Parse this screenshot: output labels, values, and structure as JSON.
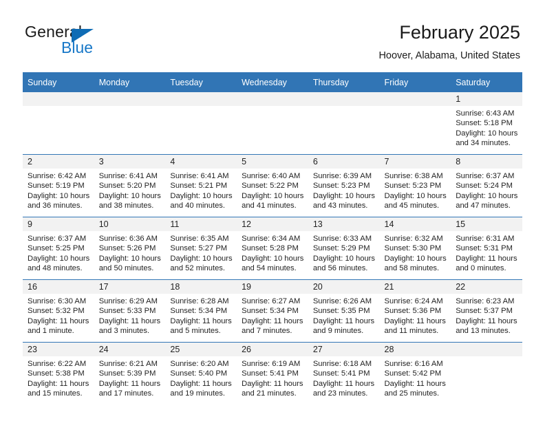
{
  "brand": {
    "name_part1": "General",
    "name_part2": "Blue"
  },
  "header": {
    "title": "February 2025",
    "subtitle": "Hoover, Alabama, United States"
  },
  "colors": {
    "header_blue": "#3175b5",
    "logo_blue": "#1878c8",
    "date_band": "#f2f2f2"
  },
  "calendar": {
    "weekday_headers": [
      "Sunday",
      "Monday",
      "Tuesday",
      "Wednesday",
      "Thursday",
      "Friday",
      "Saturday"
    ],
    "weeks": [
      [
        {
          "blank": true
        },
        {
          "blank": true
        },
        {
          "blank": true
        },
        {
          "blank": true
        },
        {
          "blank": true
        },
        {
          "blank": true
        },
        {
          "day": "1",
          "sunrise": "Sunrise: 6:43 AM",
          "sunset": "Sunset: 5:18 PM",
          "daylight_line1": "Daylight: 10 hours",
          "daylight_line2": "and 34 minutes."
        }
      ],
      [
        {
          "day": "2",
          "sunrise": "Sunrise: 6:42 AM",
          "sunset": "Sunset: 5:19 PM",
          "daylight_line1": "Daylight: 10 hours",
          "daylight_line2": "and 36 minutes."
        },
        {
          "day": "3",
          "sunrise": "Sunrise: 6:41 AM",
          "sunset": "Sunset: 5:20 PM",
          "daylight_line1": "Daylight: 10 hours",
          "daylight_line2": "and 38 minutes."
        },
        {
          "day": "4",
          "sunrise": "Sunrise: 6:41 AM",
          "sunset": "Sunset: 5:21 PM",
          "daylight_line1": "Daylight: 10 hours",
          "daylight_line2": "and 40 minutes."
        },
        {
          "day": "5",
          "sunrise": "Sunrise: 6:40 AM",
          "sunset": "Sunset: 5:22 PM",
          "daylight_line1": "Daylight: 10 hours",
          "daylight_line2": "and 41 minutes."
        },
        {
          "day": "6",
          "sunrise": "Sunrise: 6:39 AM",
          "sunset": "Sunset: 5:23 PM",
          "daylight_line1": "Daylight: 10 hours",
          "daylight_line2": "and 43 minutes."
        },
        {
          "day": "7",
          "sunrise": "Sunrise: 6:38 AM",
          "sunset": "Sunset: 5:23 PM",
          "daylight_line1": "Daylight: 10 hours",
          "daylight_line2": "and 45 minutes."
        },
        {
          "day": "8",
          "sunrise": "Sunrise: 6:37 AM",
          "sunset": "Sunset: 5:24 PM",
          "daylight_line1": "Daylight: 10 hours",
          "daylight_line2": "and 47 minutes."
        }
      ],
      [
        {
          "day": "9",
          "sunrise": "Sunrise: 6:37 AM",
          "sunset": "Sunset: 5:25 PM",
          "daylight_line1": "Daylight: 10 hours",
          "daylight_line2": "and 48 minutes."
        },
        {
          "day": "10",
          "sunrise": "Sunrise: 6:36 AM",
          "sunset": "Sunset: 5:26 PM",
          "daylight_line1": "Daylight: 10 hours",
          "daylight_line2": "and 50 minutes."
        },
        {
          "day": "11",
          "sunrise": "Sunrise: 6:35 AM",
          "sunset": "Sunset: 5:27 PM",
          "daylight_line1": "Daylight: 10 hours",
          "daylight_line2": "and 52 minutes."
        },
        {
          "day": "12",
          "sunrise": "Sunrise: 6:34 AM",
          "sunset": "Sunset: 5:28 PM",
          "daylight_line1": "Daylight: 10 hours",
          "daylight_line2": "and 54 minutes."
        },
        {
          "day": "13",
          "sunrise": "Sunrise: 6:33 AM",
          "sunset": "Sunset: 5:29 PM",
          "daylight_line1": "Daylight: 10 hours",
          "daylight_line2": "and 56 minutes."
        },
        {
          "day": "14",
          "sunrise": "Sunrise: 6:32 AM",
          "sunset": "Sunset: 5:30 PM",
          "daylight_line1": "Daylight: 10 hours",
          "daylight_line2": "and 58 minutes."
        },
        {
          "day": "15",
          "sunrise": "Sunrise: 6:31 AM",
          "sunset": "Sunset: 5:31 PM",
          "daylight_line1": "Daylight: 11 hours",
          "daylight_line2": "and 0 minutes."
        }
      ],
      [
        {
          "day": "16",
          "sunrise": "Sunrise: 6:30 AM",
          "sunset": "Sunset: 5:32 PM",
          "daylight_line1": "Daylight: 11 hours",
          "daylight_line2": "and 1 minute."
        },
        {
          "day": "17",
          "sunrise": "Sunrise: 6:29 AM",
          "sunset": "Sunset: 5:33 PM",
          "daylight_line1": "Daylight: 11 hours",
          "daylight_line2": "and 3 minutes."
        },
        {
          "day": "18",
          "sunrise": "Sunrise: 6:28 AM",
          "sunset": "Sunset: 5:34 PM",
          "daylight_line1": "Daylight: 11 hours",
          "daylight_line2": "and 5 minutes."
        },
        {
          "day": "19",
          "sunrise": "Sunrise: 6:27 AM",
          "sunset": "Sunset: 5:34 PM",
          "daylight_line1": "Daylight: 11 hours",
          "daylight_line2": "and 7 minutes."
        },
        {
          "day": "20",
          "sunrise": "Sunrise: 6:26 AM",
          "sunset": "Sunset: 5:35 PM",
          "daylight_line1": "Daylight: 11 hours",
          "daylight_line2": "and 9 minutes."
        },
        {
          "day": "21",
          "sunrise": "Sunrise: 6:24 AM",
          "sunset": "Sunset: 5:36 PM",
          "daylight_line1": "Daylight: 11 hours",
          "daylight_line2": "and 11 minutes."
        },
        {
          "day": "22",
          "sunrise": "Sunrise: 6:23 AM",
          "sunset": "Sunset: 5:37 PM",
          "daylight_line1": "Daylight: 11 hours",
          "daylight_line2": "and 13 minutes."
        }
      ],
      [
        {
          "day": "23",
          "sunrise": "Sunrise: 6:22 AM",
          "sunset": "Sunset: 5:38 PM",
          "daylight_line1": "Daylight: 11 hours",
          "daylight_line2": "and 15 minutes."
        },
        {
          "day": "24",
          "sunrise": "Sunrise: 6:21 AM",
          "sunset": "Sunset: 5:39 PM",
          "daylight_line1": "Daylight: 11 hours",
          "daylight_line2": "and 17 minutes."
        },
        {
          "day": "25",
          "sunrise": "Sunrise: 6:20 AM",
          "sunset": "Sunset: 5:40 PM",
          "daylight_line1": "Daylight: 11 hours",
          "daylight_line2": "and 19 minutes."
        },
        {
          "day": "26",
          "sunrise": "Sunrise: 6:19 AM",
          "sunset": "Sunset: 5:41 PM",
          "daylight_line1": "Daylight: 11 hours",
          "daylight_line2": "and 21 minutes."
        },
        {
          "day": "27",
          "sunrise": "Sunrise: 6:18 AM",
          "sunset": "Sunset: 5:41 PM",
          "daylight_line1": "Daylight: 11 hours",
          "daylight_line2": "and 23 minutes."
        },
        {
          "day": "28",
          "sunrise": "Sunrise: 6:16 AM",
          "sunset": "Sunset: 5:42 PM",
          "daylight_line1": "Daylight: 11 hours",
          "daylight_line2": "and 25 minutes."
        },
        {
          "blank": true
        }
      ]
    ]
  }
}
